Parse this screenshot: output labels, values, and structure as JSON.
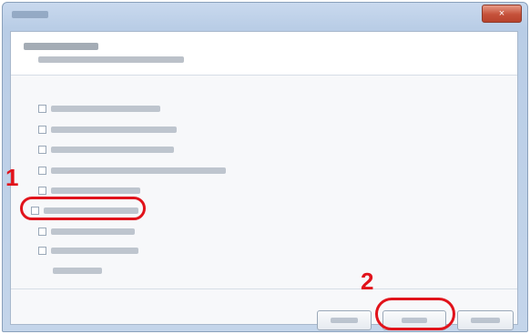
{
  "window": {
    "close_label": "×"
  },
  "callouts": [
    {
      "label": "1"
    },
    {
      "label": "2"
    }
  ]
}
